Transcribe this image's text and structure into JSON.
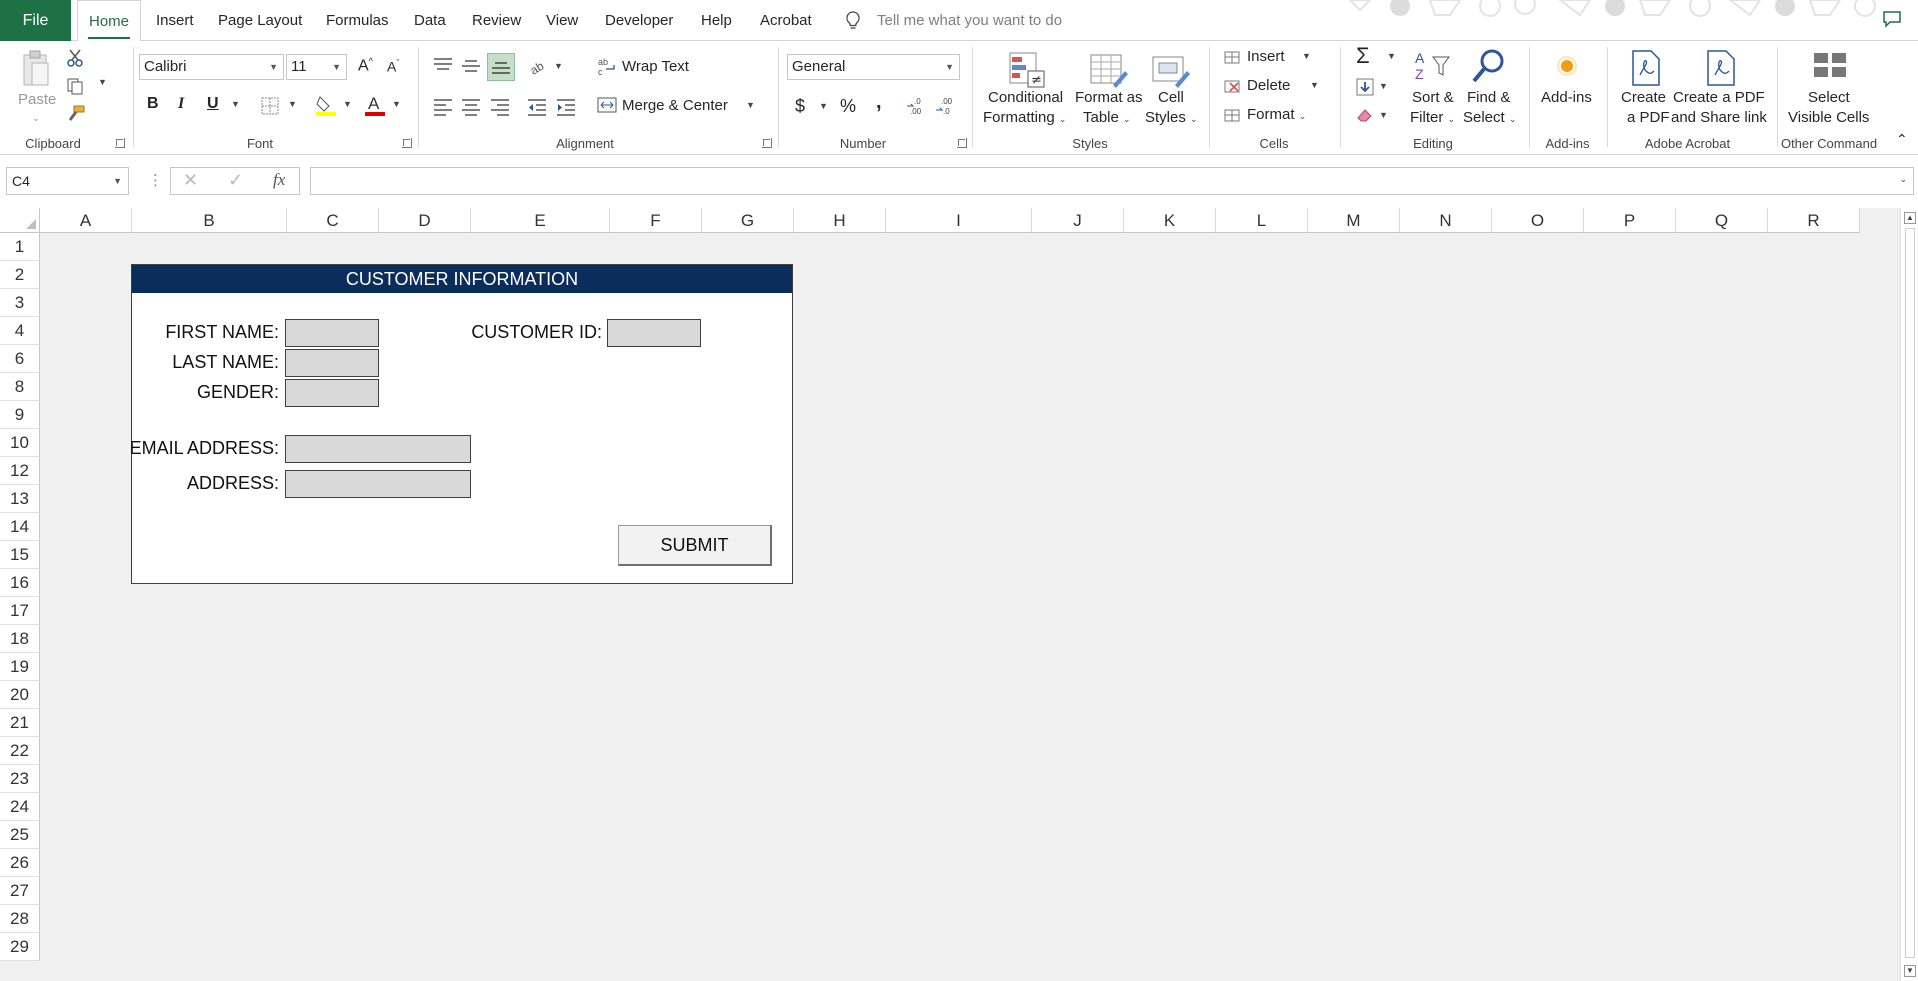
{
  "menu": {
    "file": "File",
    "tabs": [
      "Home",
      "Insert",
      "Page Layout",
      "Formulas",
      "Data",
      "Review",
      "View",
      "Developer",
      "Help",
      "Acrobat"
    ],
    "tell_me": "Tell me what you want to do"
  },
  "ribbon": {
    "clipboard": {
      "paste": "Paste",
      "label": "Clipboard"
    },
    "font": {
      "name": "Calibri",
      "size": "11",
      "bold": "B",
      "italic": "I",
      "underline": "U",
      "label": "Font"
    },
    "alignment": {
      "wrap_text": "Wrap Text",
      "merge_center": "Merge & Center",
      "label": "Alignment"
    },
    "number": {
      "format": "General",
      "currency": "$",
      "percent": "%",
      "comma": ",",
      "label": "Number"
    },
    "styles": {
      "conditional": "Conditional",
      "conditional2": "Formatting",
      "format_as": "Format as",
      "format_as2": "Table",
      "cell": "Cell",
      "cell2": "Styles",
      "label": "Styles"
    },
    "cells": {
      "insert": "Insert",
      "delete": "Delete",
      "format": "Format",
      "label": "Cells"
    },
    "editing": {
      "sort": "Sort &",
      "sort2": "Filter",
      "find": "Find &",
      "find2": "Select",
      "label": "Editing"
    },
    "addins": {
      "addins": "Add-ins",
      "label": "Add-ins"
    },
    "acrobat": {
      "create": "Create",
      "create2": "a PDF",
      "share": "Create a PDF",
      "share2": "and Share link",
      "label": "Adobe Acrobat"
    },
    "other": {
      "select": "Select",
      "select2": "Visible Cells",
      "label": "Other Command"
    }
  },
  "formula_bar": {
    "name_box": "C4",
    "fx": "fx",
    "formula": ""
  },
  "grid": {
    "columns": [
      "A",
      "B",
      "C",
      "D",
      "E",
      "F",
      "G",
      "H",
      "I",
      "J",
      "K",
      "L",
      "M",
      "N",
      "O",
      "P",
      "Q",
      "R"
    ],
    "rows": [
      "1",
      "2",
      "3",
      "4",
      "6",
      "8",
      "9",
      "10",
      "12",
      "13",
      "14",
      "15",
      "16",
      "17",
      "18",
      "19",
      "20",
      "21",
      "22",
      "23",
      "24",
      "25",
      "26",
      "27",
      "28",
      "29"
    ]
  },
  "form": {
    "title": "CUSTOMER INFORMATION",
    "first_name": "FIRST NAME:",
    "last_name": "LAST NAME:",
    "gender": "GENDER:",
    "customer_id": "CUSTOMER ID:",
    "email": "EMAIL ADDRESS:",
    "address": "ADDRESS:",
    "submit": "SUBMIT"
  },
  "colors": {
    "excel_green": "#1e7145",
    "form_header": "#0b2d5c",
    "input_fill": "#d9d9d9"
  }
}
